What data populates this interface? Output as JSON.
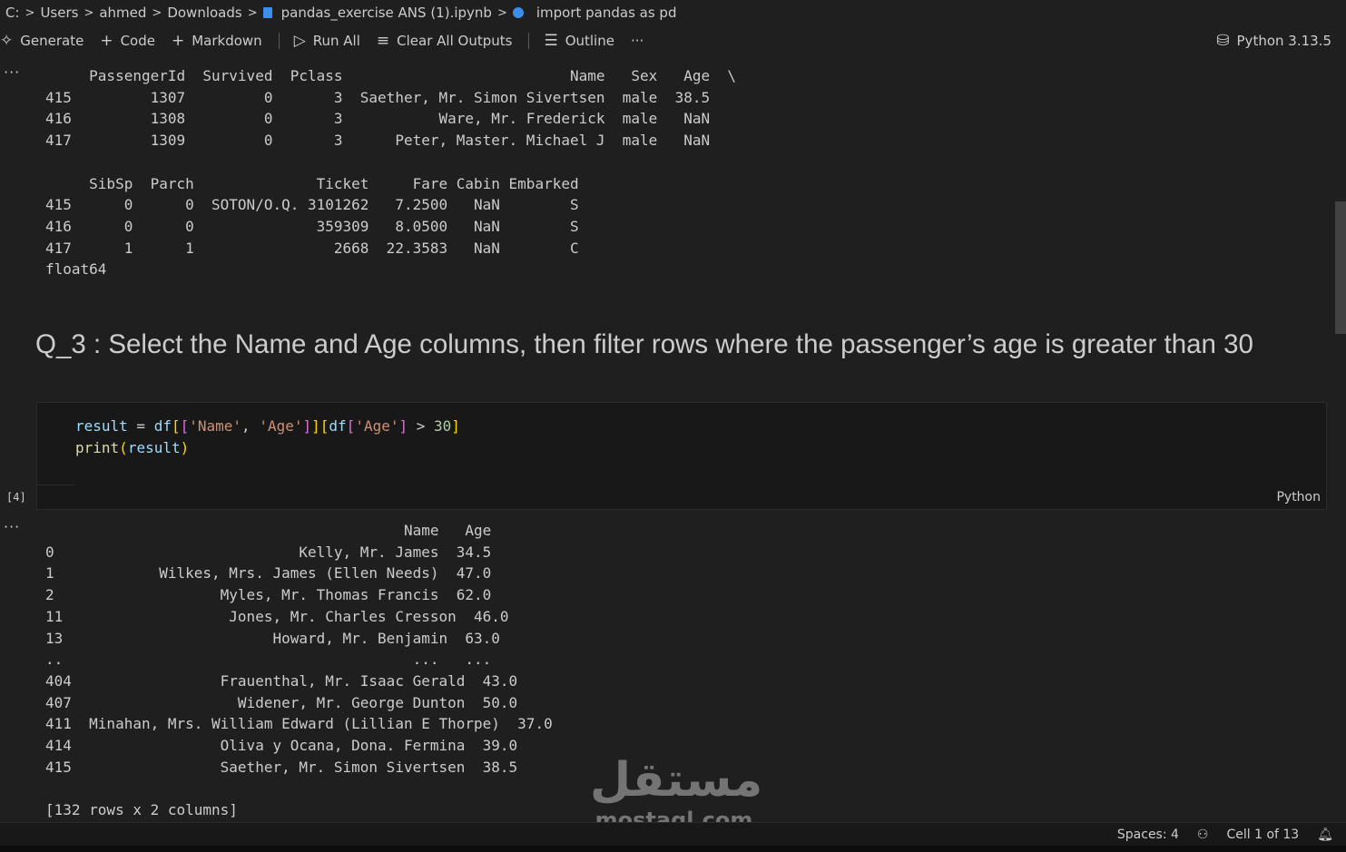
{
  "breadcrumb": {
    "items": [
      "C:",
      "Users",
      "ahmed",
      "Downloads",
      "pandas_exercise ANS (1).ipynb",
      "import pandas as pd"
    ]
  },
  "toolbar": {
    "generate": "Generate",
    "code": "Code",
    "markdown": "Markdown",
    "run_all": "Run All",
    "clear_outputs": "Clear All Outputs",
    "outline": "Outline",
    "more": "···",
    "kernel": "Python 3.13.5"
  },
  "output1": {
    "dots": "···",
    "text": "     PassengerId  Survived  Pclass                          Name   Sex   Age  \\\n415         1307         0       3  Saether, Mr. Simon Sivertsen  male  38.5\n416         1308         0       3           Ware, Mr. Frederick  male   NaN\n417         1309         0       3      Peter, Master. Michael J  male   NaN\n\n     SibSp  Parch              Ticket     Fare Cabin Embarked\n415      0      0  SOTON/O.Q. 3101262   7.2500   NaN        S\n416      0      0              359309   8.0500   NaN        S\n417      1      1                2668  22.3583   NaN        C\nfloat64"
  },
  "markdown_cell": {
    "heading": "Q_3 : Select the Name and Age columns, then filter rows where the passenger’s age is greater than 30"
  },
  "code_cell": {
    "exec_count": "[4]",
    "language": "Python",
    "line1": {
      "var": "result",
      "op": " = ",
      "df1": "df",
      "br_open_outer": "[",
      "br_open_inner": "[",
      "str_name": "'Name'",
      "comma": ", ",
      "str_age": "'Age'",
      "br_close_inner": "]",
      "br_close_outer": "]",
      "br_open2": "[",
      "df2": "df",
      "br_open3": "[",
      "str_age2": "'Age'",
      "br_close3": "]",
      "gt": " > ",
      "num": "30",
      "br_close2": "]"
    },
    "line2": {
      "fn": "print",
      "paren_open": "(",
      "arg": "result",
      "paren_close": ")"
    }
  },
  "output2": {
    "dots": "···",
    "text": "                                         Name   Age\n0                            Kelly, Mr. James  34.5\n1            Wilkes, Mrs. James (Ellen Needs)  47.0\n2                   Myles, Mr. Thomas Francis  62.0\n11                   Jones, Mr. Charles Cresson  46.0\n13                        Howard, Mr. Benjamin  63.0\n..                                        ...   ...\n404                 Frauenthal, Mr. Isaac Gerald  43.0\n407                   Widener, Mr. George Dunton  50.0\n411  Minahan, Mrs. William Edward (Lillian E Thorpe)  37.0\n414                 Oliva y Ocana, Dona. Fermina  39.0\n415                 Saether, Mr. Simon Sivertsen  38.5\n\n[132 rows x 2 columns]"
  },
  "statusbar": {
    "spaces": "Spaces: 4",
    "cell": "Cell 1 of 13"
  },
  "watermark": {
    "arabic": "مستقل",
    "latin": "mostaql.com"
  },
  "colors": {
    "background": "#1f1f1f",
    "code_bg": "#181818",
    "text": "#cccccc",
    "string": "#ce9178",
    "variable": "#9cdcfe",
    "function": "#dcdcaa"
  }
}
